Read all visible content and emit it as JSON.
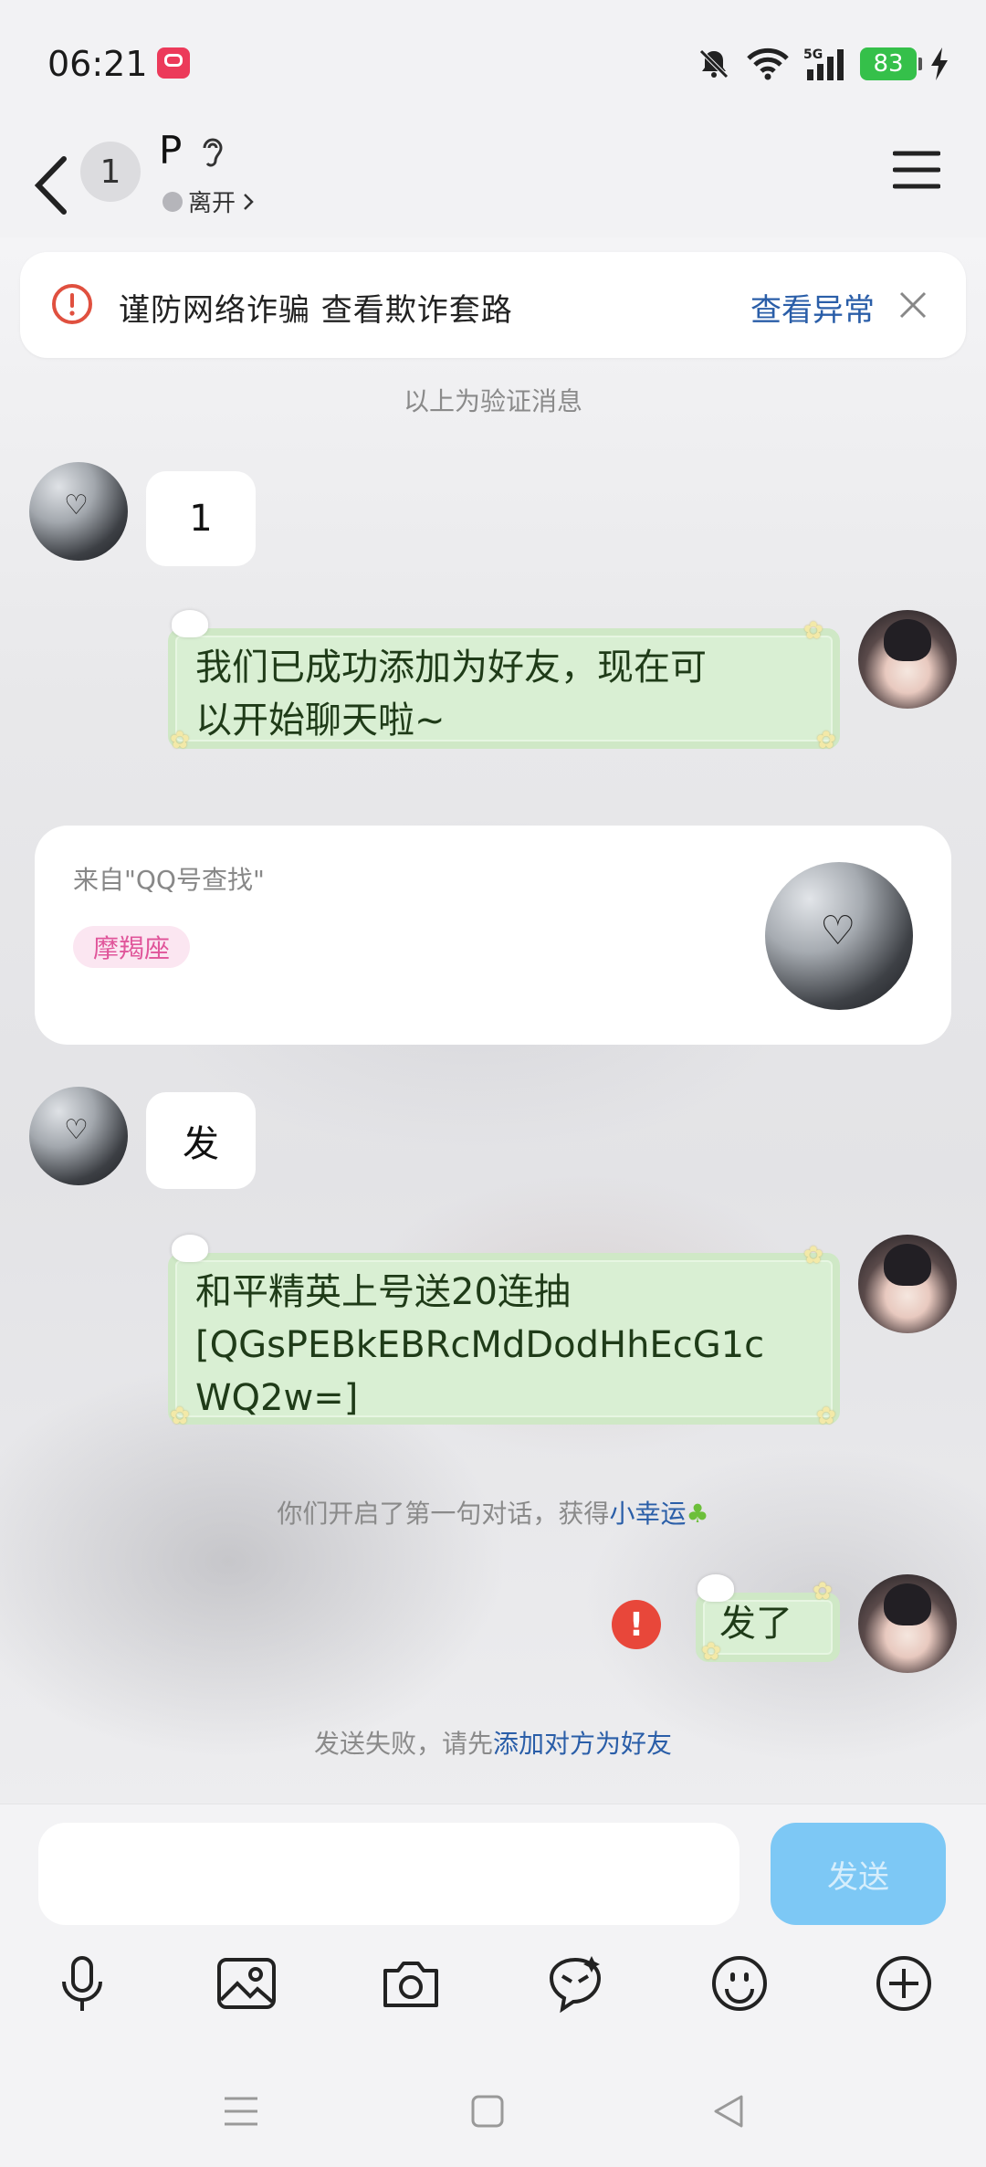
{
  "status_bar": {
    "time": "06:21",
    "battery": "83",
    "network": "5G"
  },
  "header": {
    "unread_count": "1",
    "contact_name": "P",
    "presence": "离开"
  },
  "warning": {
    "text": "谨防网络诈骗 查看欺诈套路",
    "link": "查看异常"
  },
  "messages": {
    "verify_note": "以上为验证消息",
    "m1": "1",
    "m2_line1": "我们已成功添加为好友，现在可",
    "m2_line2": "以开始聊天啦~",
    "m3": "发",
    "m4_line1": "和平精英上号送20连抽",
    "m4_line2": "[QGsPEBkEBRcMdDodHhEcG1c",
    "m4_line3": "WQ2w=]",
    "m5": "发了",
    "first_chat_note": "你们开启了第一句对话，获得",
    "first_chat_link": "小幸运",
    "fail_note": "发送失败，请先",
    "fail_link": "添加对方为好友",
    "fail_mark": "!"
  },
  "profile_card": {
    "from": "来自\"QQ号查找\"",
    "tag": "摩羯座"
  },
  "input": {
    "send_label": "发送",
    "value": ""
  },
  "colors": {
    "link": "#2a5ea8",
    "send_button": "#7dc8f5",
    "bubble_green": "#d9efd3",
    "error": "#e8473a"
  }
}
